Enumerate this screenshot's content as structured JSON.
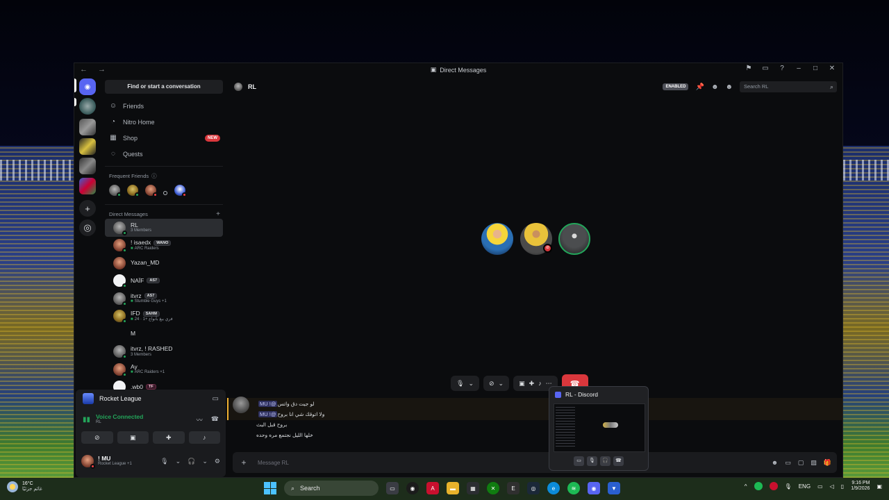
{
  "window": {
    "title": "Direct Messages",
    "nav_arrows": "← →"
  },
  "rail": {
    "servers": [
      "discord-home",
      "server-1",
      "server-2",
      "server-3",
      "server-4",
      "server-5"
    ]
  },
  "sidebar": {
    "find_label": "Find or start a conversation",
    "nav": [
      {
        "label": "Friends",
        "icon": "friends-icon"
      },
      {
        "label": "Nitro Home",
        "icon": "nitro-icon"
      },
      {
        "label": "Shop",
        "icon": "shop-icon",
        "badge": "NEW"
      },
      {
        "label": "Quests",
        "icon": "quests-icon"
      }
    ],
    "frequent_friends_label": "Frequent Friends",
    "direct_messages_label": "Direct Messages",
    "dms": [
      {
        "name": "RL",
        "sub": "3 Members",
        "tag": ""
      },
      {
        "name": "! isaedx",
        "sub": "ARC Raiders",
        "tag": "WANO"
      },
      {
        "name": "Yazan_MD",
        "sub": "",
        "tag": ""
      },
      {
        "name": "NAÏF",
        "sub": "",
        "tag": "AS7"
      },
      {
        "name": "itvrz",
        "sub": "Stumble Guys +1",
        "tag": "AS7"
      },
      {
        "name": "IFD",
        "sub": "فري بيغ بأنواع +1 · 24",
        "tag": "SAHM"
      },
      {
        "name": "M",
        "sub": "",
        "tag": ""
      },
      {
        "name": "itvrz, ! RASHED",
        "sub": "3 Members",
        "tag": ""
      },
      {
        "name": "Ay",
        "sub": "ARC Raiders +1",
        "tag": ""
      },
      {
        "name": ".wb0",
        "sub": "",
        "tag": "TF"
      }
    ]
  },
  "panel": {
    "server_name": "Rocket League",
    "voice_status": "Voice Connected",
    "voice_channel": "RL",
    "user_name": "! MU",
    "user_status": "Rocket League +1"
  },
  "main": {
    "channel_name": "RL",
    "enabled_badge": "ENABLED",
    "search_placeholder": "Search RL",
    "messages": [
      "لو جيت دق واتس",
      "ولا اتوقك شي انا بروح",
      "بروح قبل البث",
      "خلها الليل نجتمع مره وحده"
    ],
    "mention": "@! MU",
    "composer_placeholder": "Message RL"
  },
  "popup": {
    "title": "RL - Discord"
  },
  "taskbar": {
    "temperature": "16°C",
    "weather_sub": "غائم جزئيًا",
    "search_label": "Search",
    "lang": "ENG",
    "time": "9:16 PM",
    "date": "1/9/2026"
  },
  "colors": {
    "blurple": "#5865f2",
    "green": "#23a55a",
    "red": "#da373c"
  }
}
